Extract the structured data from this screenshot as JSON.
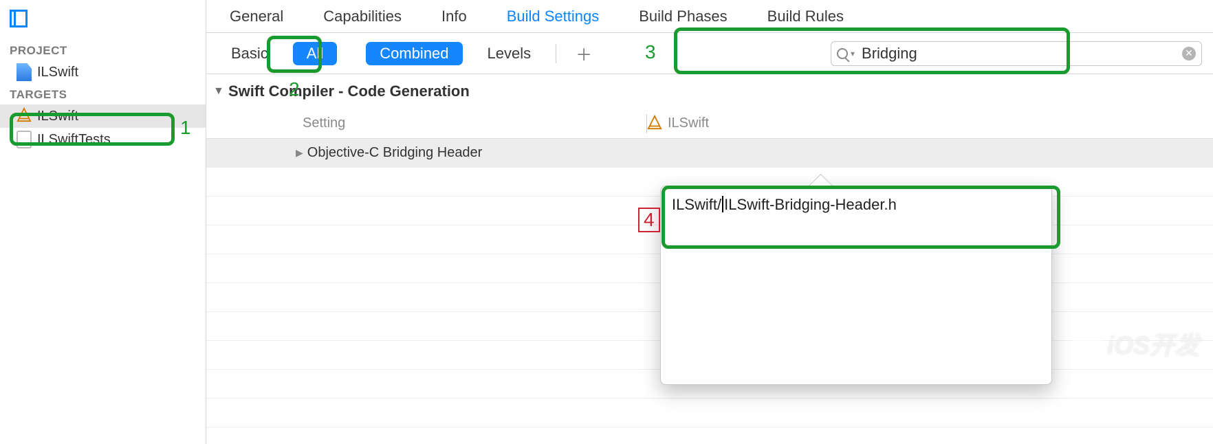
{
  "sidebar": {
    "project_label": "PROJECT",
    "targets_label": "TARGETS",
    "project_name": "ILSwift",
    "targets": [
      {
        "name": "ILSwift",
        "selected": true
      },
      {
        "name": "ILSwiftTests",
        "selected": false
      }
    ]
  },
  "tabs": {
    "items": [
      "General",
      "Capabilities",
      "Info",
      "Build Settings",
      "Build Phases",
      "Build Rules"
    ],
    "active": "Build Settings"
  },
  "filter": {
    "basic": "Basic",
    "all": "All",
    "combined": "Combined",
    "levels": "Levels",
    "search_value": "Bridging"
  },
  "settings": {
    "section": "Swift Compiler - Code Generation",
    "col_setting": "Setting",
    "col_target": "ILSwift",
    "row_name": "Objective-C Bridging Header"
  },
  "popover": {
    "value_before": "ILSwift/",
    "value_after": "ILSwift-Bridging-Header.h"
  },
  "annotations": {
    "n1": "1",
    "n2": "2",
    "n3": "3",
    "n4": "4"
  },
  "watermark": "iOS开发"
}
